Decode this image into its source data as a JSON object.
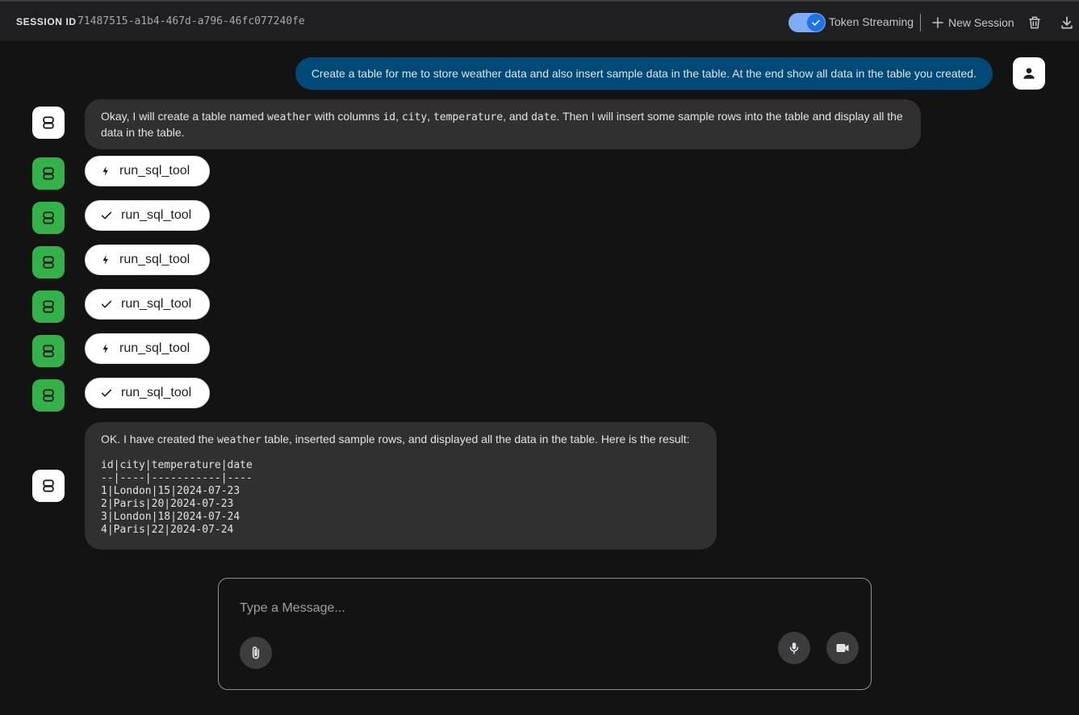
{
  "header": {
    "session_label": "SESSION ID",
    "session_id": "71487515-a1b4-467d-a796-46fc077240fe",
    "token_streaming_label": "Token Streaming",
    "token_streaming_on": true,
    "new_session_label": "New Session"
  },
  "messages": {
    "user_prompt": "Create a table for me to store weather data and also insert sample data in the table. At the end show all data in the table you created.",
    "bot_intro": {
      "t1": "Okay, I will create a table named ",
      "c1": "weather",
      "t2": " with columns ",
      "c2": "id",
      "t3": ", ",
      "c3": "city",
      "t4": ", ",
      "c4": "temperature",
      "t5": ", and ",
      "c5": "date",
      "t6": ". Then I will insert some sample rows into the table and display all the data in the table."
    },
    "tools": [
      {
        "label": "run_sql_tool",
        "status": "call",
        "icon": "bolt-icon"
      },
      {
        "label": "run_sql_tool",
        "status": "done",
        "icon": "check-icon"
      },
      {
        "label": "run_sql_tool",
        "status": "call",
        "icon": "bolt-icon"
      },
      {
        "label": "run_sql_tool",
        "status": "done",
        "icon": "check-icon"
      },
      {
        "label": "run_sql_tool",
        "status": "call",
        "icon": "bolt-icon"
      },
      {
        "label": "run_sql_tool",
        "status": "done",
        "icon": "check-icon"
      }
    ],
    "bot_result": {
      "t1": "OK. I have created the ",
      "c1": "weather",
      "t2": " table, inserted sample rows, and displayed all the data in the table. Here is the result:",
      "rows": [
        "id|city|temperature|date",
        "--|----|-----------|----",
        "1|London|15|2024-07-23",
        "2|Paris|20|2024-07-23",
        "3|London|18|2024-07-24",
        "4|Paris|22|2024-07-24"
      ]
    }
  },
  "composer": {
    "placeholder": "Type a Message..."
  },
  "colors": {
    "background": "#131314",
    "user_bubble": "#004a77",
    "bot_bubble": "#303030",
    "tool_avatar": "#33b24a",
    "toggle_accent": "#1a73e8"
  }
}
